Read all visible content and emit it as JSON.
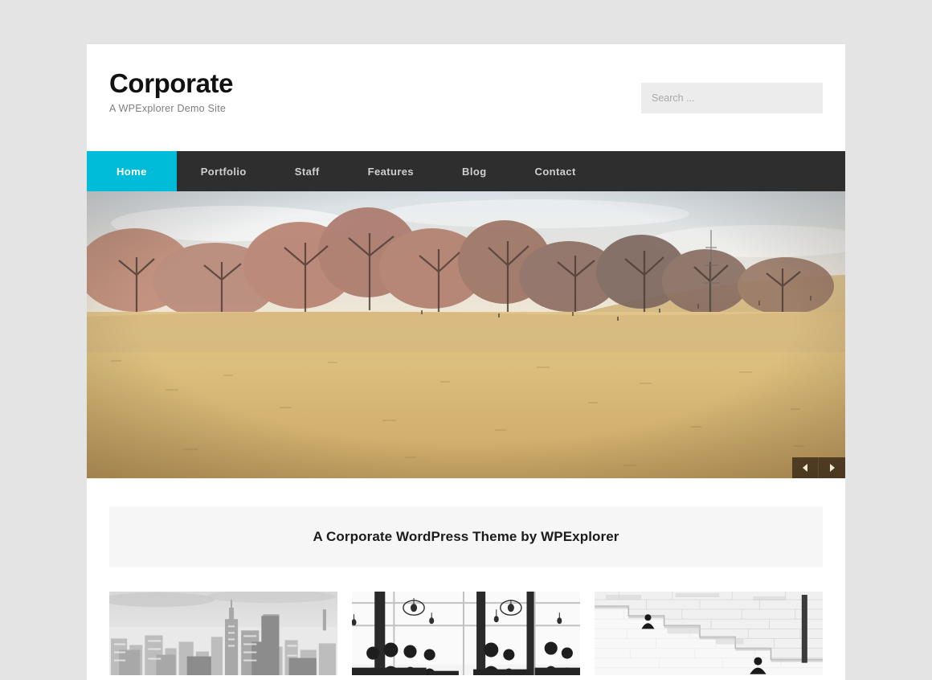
{
  "theme": {
    "accent_color": "#00bcd9",
    "nav_background": "#2e2e2e",
    "page_background": "#e4e4e4",
    "container_background": "#ffffff",
    "callout_background": "#f6f6f6",
    "search_background": "#ececec"
  },
  "header": {
    "site_title": "Corporate",
    "tagline": "A WPExplorer Demo Site"
  },
  "search": {
    "placeholder": "Search ...",
    "value": "",
    "icon": "search-icon"
  },
  "nav": {
    "items": [
      {
        "label": "Home",
        "active": true
      },
      {
        "label": "Portfolio",
        "active": false
      },
      {
        "label": "Staff",
        "active": false
      },
      {
        "label": "Features",
        "active": false
      },
      {
        "label": "Blog",
        "active": false
      },
      {
        "label": "Contact",
        "active": false
      }
    ]
  },
  "slider": {
    "alt": "Person sitting on dry golden grass in a park, wearing teal canvas sneakers and blue jeans, with bare autumn trees and a hill in the background",
    "prev_icon": "chevron-left-icon",
    "next_icon": "chevron-right-icon",
    "prev_label": "Previous slide",
    "next_label": "Next slide"
  },
  "callout": {
    "text": "A Corporate WordPress Theme by WPExplorer"
  },
  "features": [
    {
      "alt": "Black and white aerial photograph of the New York City skyline with skyscrapers"
    },
    {
      "alt": "Black and white photograph of silhouetted people seated at tables in front of tall windows"
    },
    {
      "alt": "Black and white photograph of a wide stone staircase with two seated figures"
    }
  ]
}
